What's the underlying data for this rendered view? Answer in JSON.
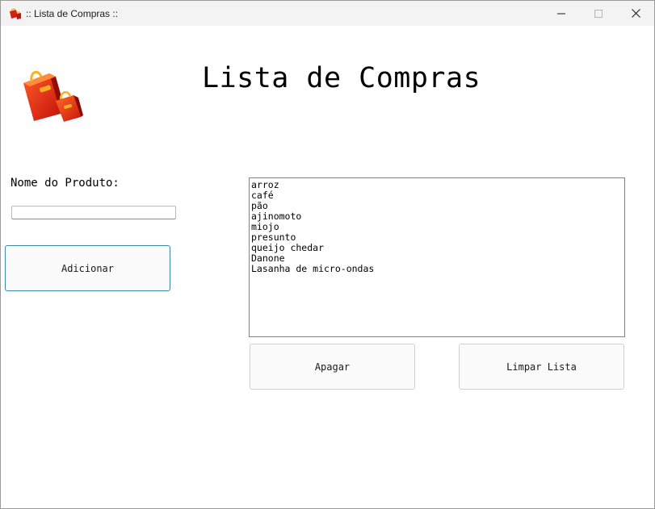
{
  "window": {
    "title": ":: Lista de Compras ::",
    "icons": {
      "app": "shopping-bags-icon",
      "minimize": "minimize-icon",
      "maximize": "maximize-icon",
      "close": "close-icon"
    }
  },
  "main": {
    "heading": "Lista de Compras",
    "logo_icon": "shopping-bags-icon",
    "product_label": "Nome do Produto:",
    "product_input_value": "",
    "add_button": "Adicionar",
    "delete_button": "Apagar",
    "clear_button": "Limpar Lista",
    "items": [
      "arroz",
      "café",
      "pão",
      "ajinomoto",
      "miojo",
      "presunto",
      "queijo chedar",
      "Danone",
      "Lasanha de micro-ondas"
    ]
  },
  "colors": {
    "accent_border": "#3b8aa6",
    "titlebar": "#f3f3f3",
    "bag_red": "#d81f0e",
    "bag_orange": "#f0a11d"
  }
}
